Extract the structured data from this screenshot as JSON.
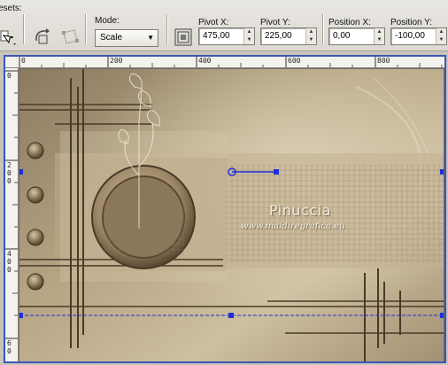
{
  "toolbar": {
    "presets_label": "esets:",
    "mode_label": "Mode:",
    "mode_value": "Scale",
    "pivot_x_label": "Pivot X:",
    "pivot_x_value": "475,00",
    "pivot_y_label": "Pivot Y:",
    "pivot_y_value": "225,00",
    "position_x_label": "Position X:",
    "position_x_value": "0,00",
    "position_y_label": "Position Y:",
    "position_y_value": "-100,00"
  },
  "rulers": {
    "top_labels": [
      "0",
      "200",
      "400",
      "600",
      "800"
    ],
    "left_labels": [
      [
        "0"
      ],
      [
        "2",
        "0",
        "0"
      ],
      [
        "4",
        "0",
        "0"
      ],
      [
        "6",
        "0"
      ]
    ]
  },
  "canvas": {
    "watermark_title": "Pinuccia",
    "watermark_url": "www.maidiregrafica.eu"
  },
  "colors": {
    "selection_frame": "#3a57b8",
    "handle": "#1f2fd6",
    "sepia_light": "#c9b896",
    "sepia_dark": "#4a3a28"
  }
}
